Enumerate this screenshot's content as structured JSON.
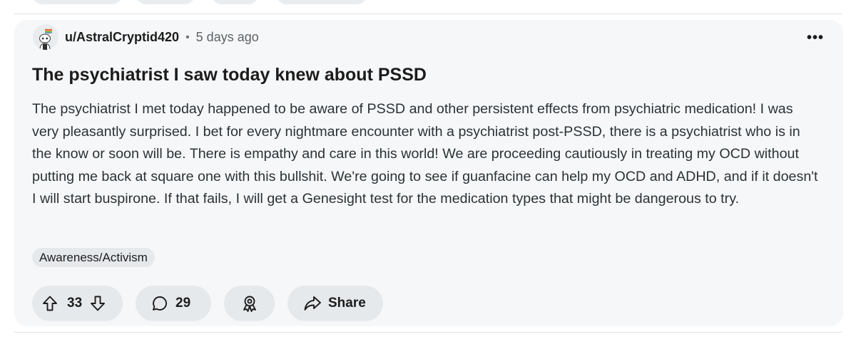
{
  "post": {
    "username": "u/AstralCryptid420",
    "separator": "•",
    "time_ago": "5 days ago",
    "more_label": "•••",
    "title": "The psychiatrist I saw today knew about PSSD",
    "body": "The psychiatrist I met today happened to be aware of PSSD and other persistent effects from psychiatric medication! I was very pleasantly surprised. I bet for every nightmare encounter with a psychiatrist post-PSSD, there is a psychiatrist who is in the know or soon will be. There is empathy and care in this world! We are proceeding cautiously in treating my OCD without putting me back at square one with this bullshit. We're going to see if guanfacine can help my OCD and ADHD, and if it doesn't I will start buspirone. If that fails, I will get a Genesight test for the medication types that might be dangerous to try.",
    "flair": "Awareness/Activism"
  },
  "actions": {
    "vote_count": "33",
    "comment_count": "29",
    "share_label": "Share"
  },
  "icons": {
    "avatar": "snoo-avatar-icon",
    "upvote": "upvote-arrow-icon",
    "downvote": "downvote-arrow-icon",
    "comment": "comment-bubble-icon",
    "award": "award-icon",
    "share": "share-arrow-icon",
    "more": "more-options-icon"
  },
  "colors": {
    "card_background": "#f6f7f8",
    "button_background": "#e6e9ec",
    "text_primary": "#1c1c1c",
    "text_secondary": "#5c6266"
  }
}
